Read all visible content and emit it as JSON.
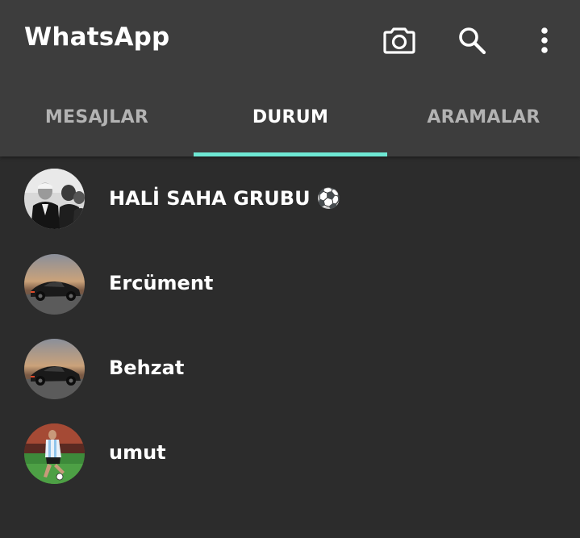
{
  "app": {
    "title": "WhatsApp"
  },
  "actions": [
    {
      "icon": "camera-icon"
    },
    {
      "icon": "search-icon"
    },
    {
      "icon": "more-vertical-icon"
    }
  ],
  "tabs": [
    {
      "label": "MESAJLAR",
      "active": false
    },
    {
      "label": "DURUM",
      "active": true
    },
    {
      "label": "ARAMALAR",
      "active": false
    }
  ],
  "colors": {
    "appbar": "#3d3d3d",
    "background": "#2c2c2c",
    "tab_indicator": "#6ee7d3",
    "text_primary": "#ffffff",
    "text_inactive": "#b3b3b3"
  },
  "contacts": [
    {
      "name": "HALİ SAHA GRUBU ⚽",
      "avatar": "group-photo-avatar"
    },
    {
      "name": "Ercüment",
      "avatar": "sports-car-avatar"
    },
    {
      "name": "Behzat",
      "avatar": "sports-car-avatar"
    },
    {
      "name": "umut",
      "avatar": "football-player-avatar"
    }
  ]
}
